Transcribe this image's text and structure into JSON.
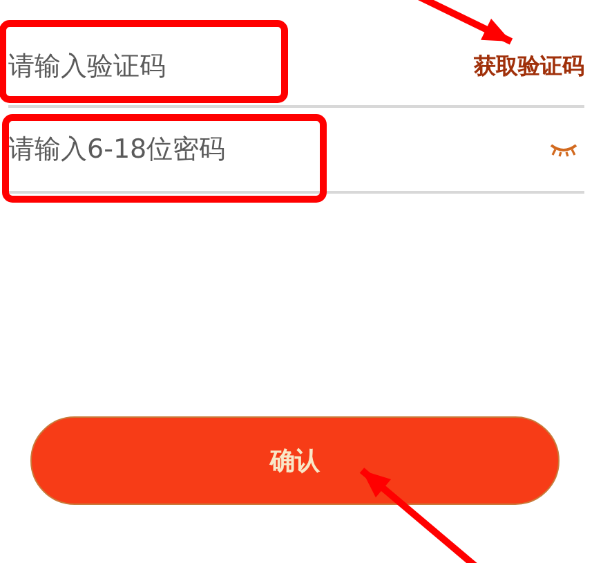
{
  "fields": [
    {
      "kind": "code",
      "placeholder": "请输入验证码",
      "action": "获取验证码"
    },
    {
      "kind": "password",
      "placeholder": "请输入6-18位密码",
      "masked": true
    }
  ],
  "confirm_button": "确认",
  "annotations": [
    {
      "kind": "box"
    },
    {
      "kind": "box"
    },
    {
      "kind": "arrow"
    },
    {
      "kind": "arrow"
    }
  ]
}
